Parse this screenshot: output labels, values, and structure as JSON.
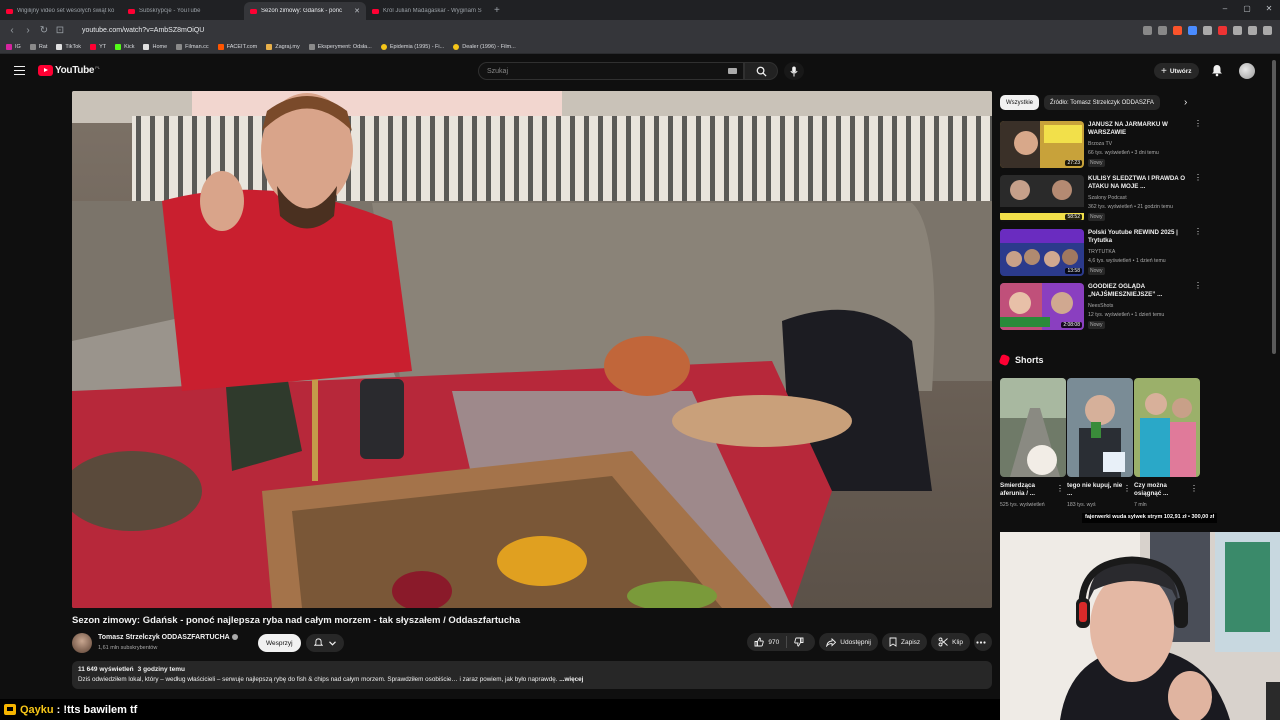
{
  "browser": {
    "tabs": [
      {
        "label": "Wigilijny video set wesołych świąt ko",
        "active": false
      },
      {
        "label": "Subskrypcje - YouTube",
        "active": false
      },
      {
        "label": "Sezon zimowy: Gdańsk - ponc",
        "active": true
      },
      {
        "label": "Król Julian Madagaskar - Wyginam Ś",
        "active": false
      }
    ],
    "new_tab": "+",
    "window_controls": [
      "–",
      "▢",
      "✕"
    ],
    "url": "youtube.com/watch?v=AmbSZ8mOiQU",
    "bookmarks": [
      {
        "label": "IG",
        "color": "#d6249f"
      },
      {
        "label": "Rat",
        "color": "#8a8a8a"
      },
      {
        "label": "TikTok",
        "color": "#e0e0e0"
      },
      {
        "label": "YT",
        "color": "#ff0033"
      },
      {
        "label": "Kick",
        "color": "#53fc18"
      },
      {
        "label": "Home",
        "color": "#e0e0e0"
      },
      {
        "label": "Filman.cc",
        "color": "#8a8a8a"
      },
      {
        "label": "FACEIT.com",
        "color": "#ff5500"
      },
      {
        "label": "Zagraj.my",
        "color": "#e8b04a"
      },
      {
        "label": "Eksperyment: Odsła...",
        "color": "#8a8a8a"
      },
      {
        "label": "Epidemia (1995) - Fi...",
        "color": "#f5c518"
      },
      {
        "label": "Dealer (1996) - Film...",
        "color": "#f5c518"
      }
    ]
  },
  "masthead": {
    "logo_text": "YouTube",
    "country": "PL",
    "search_placeholder": "Szukaj",
    "create_label": "Utwórz"
  },
  "video": {
    "title": "Sezon zimowy: Gdańsk - ponoć najlepsza ryba nad całym morzem - tak słyszałem / Oddaszfartucha",
    "channel": "Tomasz Strzelczyk ODDASZFARTUCHA",
    "subscribers": "1,61 mln subskrybentów",
    "support_label": "Wesprzyj",
    "likes": "970",
    "share_label": "Udostępnij",
    "save_label": "Zapisz",
    "clip_label": "Klip",
    "views": "11 649 wyświetleń",
    "posted": "3 godziny temu",
    "description": "Dziś odwiedziłem lokal, który – według właścicieli – serwuje najlepszą rybę do fish & chips nad całym morzem. Sprawdziłem osobiście… i zaraz powiem, jak było naprawdę.",
    "more_label": "...więcej"
  },
  "sidebar": {
    "chips": [
      {
        "label": "Wszystkie",
        "active": true
      },
      {
        "label": "Źródło: Tomasz Strzelczyk ODDASZFA",
        "active": false
      }
    ],
    "recommendations": [
      {
        "title": "JANUSZ NA JARMARKU W WARSZAWIE",
        "channel": "Brzoza TV",
        "meta": "66 tys. wyświetleń • 3 dni temu",
        "badge": "Nowy",
        "duration": "27:23",
        "thumb_color": "#c8a23a"
      },
      {
        "title": "KULISY ŚLEDZTWA I PRAWDA O ATAKU NA MOJE ...",
        "channel": "Szalony Podcast",
        "meta": "362 tys. wyświetleń • 21 godzin temu",
        "badge": "Nowy",
        "duration": "58:52",
        "thumb_color": "#2a2a2a"
      },
      {
        "title": "Polski Youtube REWIND 2025 | Trytutka",
        "channel": "TRYTUTKA",
        "meta": "4,6 tys. wyświetleń • 1 dzień temu",
        "badge": "Nowy",
        "duration": "13:58",
        "thumb_color": "#2b3a8c"
      },
      {
        "title": "GOODIEZ OGLĄDA „NAJŚMIESZNIEJSZE” ...",
        "channel": "NeesShots",
        "meta": "12 tys. wyświetleń • 1 dzień temu",
        "badge": "Nowy",
        "duration": "2:08:08",
        "thumb_color": "#8a3fc0"
      }
    ],
    "shorts_title": "Shorts",
    "shorts": [
      {
        "title": "Śmierdząca aferunia / ...",
        "views": "525 tys. wyświetleń",
        "thumb_color": "#6f7a68"
      },
      {
        "title": "tego nie kupuj, nie ...",
        "views": "183 tys. wyś",
        "thumb_color": "#7a8c96"
      },
      {
        "title": "Czy można osiągnąć ...",
        "views": "7 mln",
        "thumb_color": "#9bb06a"
      }
    ]
  },
  "overlay": {
    "donation": "fajerwerki wuda sylwek strym  102,91 zł  •  300,00 zł",
    "chat_user": "Qayku",
    "chat_message": ": !tts bawilem tf"
  },
  "colors": {
    "background": "#0f0f0f",
    "accent_red": "#ff0033",
    "surface": "#272727",
    "text_secondary": "#aaaaaa",
    "chat_name": "#f5c518"
  }
}
